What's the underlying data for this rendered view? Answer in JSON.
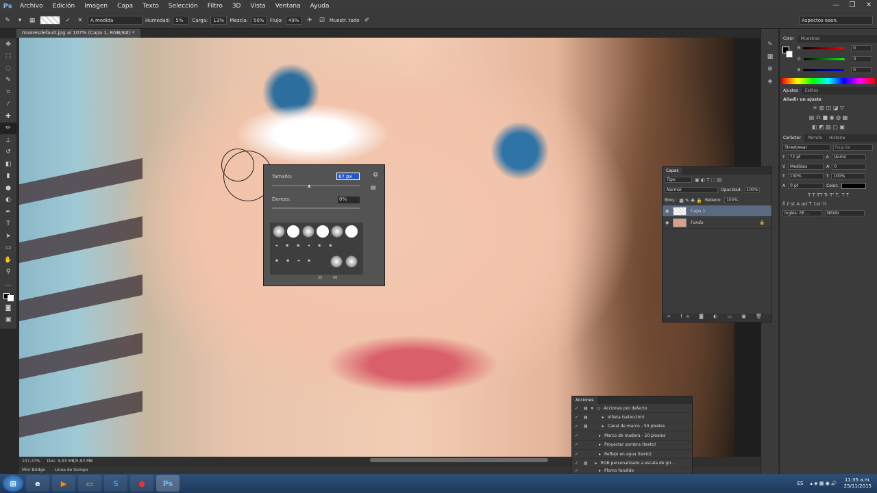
{
  "app": {
    "logo": "Ps"
  },
  "menu": [
    "Archivo",
    "Edición",
    "Imagen",
    "Capa",
    "Texto",
    "Selección",
    "Filtro",
    "3D",
    "Vista",
    "Ventana",
    "Ayuda"
  ],
  "window_controls": [
    "—",
    "❐",
    "✕"
  ],
  "options_bar": {
    "mode_label": "A medida",
    "humedad_label": "Humedad:",
    "humedad_value": "5%",
    "carga_label": "Carga:",
    "carga_value": "13%",
    "mezcla_label": "Mezcla:",
    "mezcla_value": "50%",
    "flujo_label": "Flujo:",
    "flujo_value": "49%",
    "muestrear_label": "Muestr. todo",
    "workspace": "Aspectos esen."
  },
  "document_tab": "maxresdefault.jpg al 107% (Capa 1, RGB/8#) *",
  "status": {
    "zoom": "107,37%",
    "doc": "Doc: 5,93 MB/5,93 MB"
  },
  "bridge_tabs": [
    "Mini Bridge",
    "Línea de tiempo"
  ],
  "brush_popup": {
    "size_label": "Tamaño:",
    "size_value": "67 px",
    "hardness_label": "Dureza:",
    "hardness_value": "0%",
    "size_numbers": [
      "25",
      "50"
    ]
  },
  "color_panel": {
    "tabs": [
      "Color",
      "Muestras"
    ],
    "channels": [
      {
        "name": "R",
        "value": "0"
      },
      {
        "name": "G",
        "value": "0"
      },
      {
        "name": "B",
        "value": "0"
      }
    ]
  },
  "adjust_panel": {
    "tabs": [
      "Ajustes",
      "Estilos"
    ],
    "title": "Añadir un ajuste"
  },
  "char_panel": {
    "tabs": [
      "Carácter",
      "Párrafo",
      "Historia"
    ],
    "font": "Streetwear",
    "style": "Regular",
    "size": "72 pt",
    "leading": "(Auto)",
    "kerning": "Medidas",
    "tracking": "0",
    "vscale": "100%",
    "hscale": "100%",
    "baseline": "0 pt",
    "color_label": "Color:",
    "language": "Inglés: EE....",
    "aa": "Nítido"
  },
  "layers_panel": {
    "tab": "Capas",
    "filter": "Tipo",
    "blend": "Normal",
    "opacity_label": "Opacidad:",
    "opacity": "100%",
    "lock_label": "Bloq.:",
    "fill_label": "Relleno:",
    "fill": "100%",
    "layers": [
      {
        "name": "Capa 1",
        "selected": true
      },
      {
        "name": "Fondo",
        "selected": false
      }
    ]
  },
  "actions_panel": {
    "tab": "Acciones",
    "items": [
      "Acciones por defecto",
      "Viñeta (selección)",
      "Canal de marco - 50 píxeles",
      "Marco de madera - 50 píxeles",
      "Proyectar sombra (texto)",
      "Reflejo en agua (texto)",
      "RGB personalizado a escala de gri...",
      "Plomo fundido"
    ]
  },
  "tray": {
    "lang": "ES",
    "time": "11:35 a.m.",
    "date": "25/11/2015"
  },
  "colors": {
    "accent": "#1f6fd1",
    "panel": "#3b3b3b",
    "dark": "#282828"
  }
}
